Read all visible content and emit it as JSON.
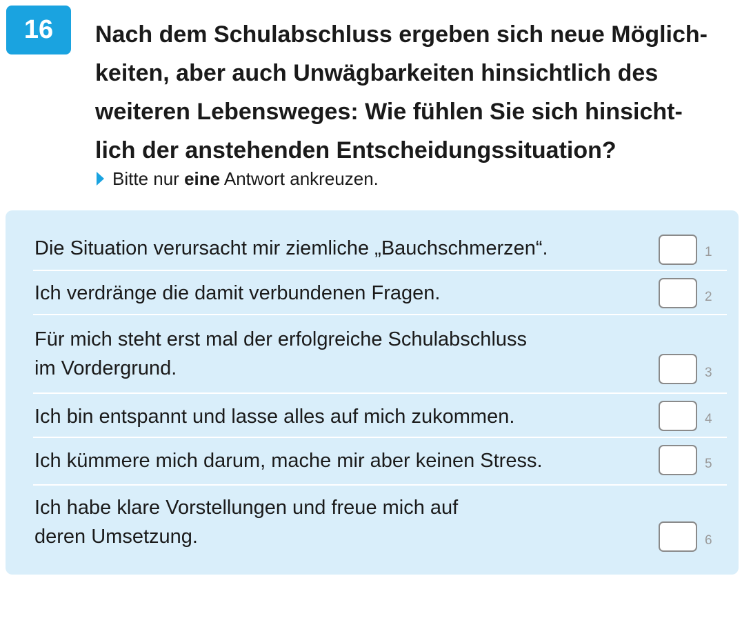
{
  "question": {
    "number": "16",
    "lines": [
      "Nach dem Schulabschluss ergeben sich neue Möglich-",
      "keiten, aber auch Unwägbarkeiten hinsichtlich des",
      "weiteren Lebensweges: Wie fühlen Sie sich hinsicht-",
      "lich der anstehenden Entscheidungssituation?"
    ]
  },
  "instruction": {
    "prefix": "Bitte nur ",
    "emphasis": "eine",
    "suffix": " Antwort ankreuzen."
  },
  "options": [
    {
      "lines": [
        "Die Situation verursacht mir ziemliche „Bauchschmerzen“."
      ],
      "code": "1",
      "checked": false
    },
    {
      "lines": [
        "Ich verdränge die damit verbundenen Fragen."
      ],
      "code": "2",
      "checked": false
    },
    {
      "lines": [
        "Für mich steht erst mal der erfolgreiche Schulabschluss",
        "im Vordergrund."
      ],
      "code": "3",
      "checked": false
    },
    {
      "lines": [
        "Ich bin entspannt und lasse alles auf mich zukommen."
      ],
      "code": "4",
      "checked": false
    },
    {
      "lines": [
        "Ich kümmere mich darum, mache mir aber keinen Stress."
      ],
      "code": "5",
      "checked": false
    },
    {
      "lines": [
        "Ich habe klare Vorstellungen und freue mich auf",
        "deren Umsetzung."
      ],
      "code": "6",
      "checked": false
    }
  ],
  "colors": {
    "accent": "#1aa3e0",
    "panel_background": "#d9eefa",
    "checkbox_border": "#8a8a8a",
    "code_text": "#9a9a9a"
  }
}
